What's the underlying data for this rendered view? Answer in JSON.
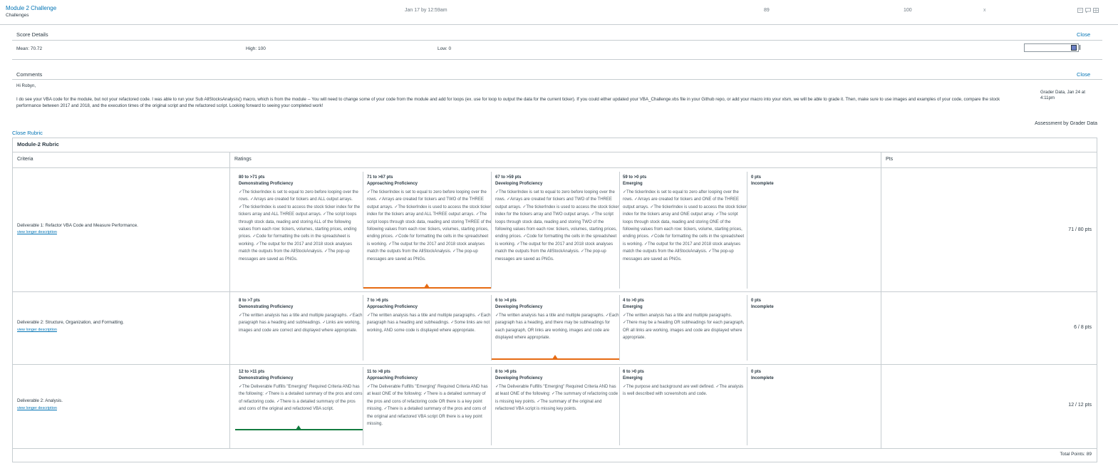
{
  "assignment": {
    "title": "Module 2 Challenge",
    "group": "Challenges",
    "due": "Jan 17 by 12:59am",
    "score": "89",
    "possible": "100",
    "x": "x"
  },
  "score_details": {
    "title": "Score Details",
    "close": "Close",
    "mean": "Mean: 70.72",
    "high": "High: 100",
    "low": "Low: 0"
  },
  "comments": {
    "title": "Comments",
    "close": "Close",
    "greeting": "Hi Robyn,",
    "body": "I do see your VBA code for the module, but not your refactored code. I was able to run your Sub AllStocksAnalysis() macro, which is from the module -- You will need to change some of your code from the module and add for loops (ex. use for loop to output the data for the current ticker). If you could either updated your VBA_Challenge.vbs file in your Github repo, or add your macro into your xlsm, we will be able to grade it. Then, make sure to use images and examples of your code, compare the stock performance between 2017 and 2018, and the execution times of the original script and the refactored script. Looking forward to seeing your completed work!",
    "grader": "Grader Data, Jan 24 at 4:11pm"
  },
  "rubric": {
    "close_link": "Close Rubric",
    "assessment_by": "Assessment by Grader Data",
    "title": "Module-2 Rubric",
    "col_criteria": "Criteria",
    "col_ratings": "Ratings",
    "col_pts": "Pts",
    "view_longer": "view longer description",
    "total": "Total Points: 89",
    "selected_color_orange": "#e66b13",
    "selected_color_green": "#127b3f",
    "criteria": [
      {
        "name": "Deliverable 1: Refactor VBA Code and Measure Performance.",
        "pts": "71 / 80 pts",
        "ratings": [
          {
            "pts": "80 to >71 pts",
            "name": "Demonstrating Proficiency",
            "desc": "✓The tickerIndex is set to equal to zero before looping over the rows. ✓Arrays are created for tickers and ALL output arrays. ✓The tickerIndex is used to access the stock ticker index for the tickers array and ALL THREE output arrays. ✓The script loops through stock data, reading and storing ALL of the following values from each row: tickers, volumes, starting prices, ending prices. ✓Code for formatting the cells in the spreadsheet is working. ✓The output for the 2017 and 2018 stock analyses match the outputs from the AllStockAnalysis. ✓The pop-up messages are saved as PNGs."
          },
          {
            "pts": "71 to >67 pts",
            "name": "Approaching Proficiency",
            "desc": "✓The tickerIndex is set to equal to zero before looping over the rows. ✓Arrays are created for tickers and TWO of the THREE output arrays. ✓The tickerIndex is used to access the stock ticker index for the tickers array and ALL THREE output arrays. ✓The script loops through stock data, reading and storing THREE of the following values from each row: tickers, volumes, starting prices, ending prices. ✓Code for formatting the cells in the spreadsheet is working. ✓The output for the 2017 and 2018 stock analyses match the outputs from the AllStockAnalysis. ✓The pop-up messages are saved as PNGs."
          },
          {
            "pts": "67 to >59 pts",
            "name": "Developing Proficiency",
            "desc": "✓The tickerIndex is set to equal to zero before looping over the rows. ✓Arrays are created for tickers and TWO of the THREE output arrays. ✓The tickerIndex is used to access the stock ticker index for the tickers array and TWO output arrays. ✓The script loops through stock data, reading and storing TWO of the following values from each row: tickers, volumes, starting prices, ending prices. ✓Code for formatting the cells in the spreadsheet is working. ✓The output for the 2017 and 2018 stock analyses match the outputs from the AllStockAnalysis. ✓The pop-up messages are saved as PNGs."
          },
          {
            "pts": "59 to >0 pts",
            "name": "Emerging",
            "desc": "✓The tickerIndex is set to equal to zero after looping over the rows. ✓Arrays are created for tickers and ONE of the THREE output arrays. ✓The tickerIndex is used to access the stock ticker index for the tickers array and ONE output array. ✓The script loops through stock data, reading and storing ONE of the following values from each row: tickers, volume, starting prices, ending prices. ✓Code for formatting the cells in the spreadsheet is working. ✓The output for the 2017 and 2018 stock analyses match the outputs from the AllStockAnalysis. ✓The pop-up messages are saved as PNGs."
          },
          {
            "pts": "0 pts",
            "name": "Incomplete",
            "desc": ""
          }
        ]
      },
      {
        "name": "Deliverable 2: Structure, Organization, and Formatting.",
        "pts": "6 / 8 pts",
        "ratings": [
          {
            "pts": "8 to >7 pts",
            "name": "Demonstrating Proficiency",
            "desc": "✓The written analysis has a title and multiple paragraphs. ✓Each paragraph has a heading and subheadings. ✓Links are working, images and code are correct and displayed where appropriate."
          },
          {
            "pts": "7 to >6 pts",
            "name": "Approaching Proficiency",
            "desc": "✓The written analysis has a title and multiple paragraphs. ✓Each paragraph has a heading and subheadings. ✓Some links are not working, AND some code is displayed where appropriate."
          },
          {
            "pts": "6 to >4 pts",
            "name": "Developing Proficiency",
            "desc": "✓The written analysis has a title and multiple paragraphs. ✓Each paragraph has a heading, and there may be subheadings for each paragraph, OR links are working, images and code are displayed where appropriate."
          },
          {
            "pts": "4 to >0 pts",
            "name": "Emerging",
            "desc": "✓The written analysis has a title and multiple paragraphs. ✓There may be a heading OR subheadings for each paragraph, OR all links are working, images and code are displayed where appropriate."
          },
          {
            "pts": "0 pts",
            "name": "Incomplete",
            "desc": ""
          }
        ]
      },
      {
        "name": "Deliverable 2: Analysis.",
        "pts": "12 / 12 pts",
        "ratings": [
          {
            "pts": "12 to >11 pts",
            "name": "Demonstrating Proficiency",
            "desc": "✓The Deliverable Fulfills \"Emerging\" Required Criteria AND has the following: ✓There is a detailed summary of the pros and cons of refactoring code. ✓There is a detailed summary of the pros and cons of the original and refactored VBA script."
          },
          {
            "pts": "11 to >8 pts",
            "name": "Approaching Proficiency",
            "desc": "✓The Deliverable Fulfills \"Emerging\" Required Criteria AND has at least ONE of the following: ✓There is a detailed summary of the pros and cons of refactoring code OR there is a key point missing. ✓There is a detailed summary of the pros and cons of the original and refactored VBA script OR there is a key point missing."
          },
          {
            "pts": "8 to >6 pts",
            "name": "Developing Proficiency",
            "desc": "✓The Deliverable Fulfills \"Emerging\" Required Criteria AND has at least ONE of the following: ✓The summary of refactoring code is missing key points. ✓The summary of the original and refactored VBA script is missing key points."
          },
          {
            "pts": "6 to >0 pts",
            "name": "Emerging",
            "desc": "✓The purpose and background are well defined. ✓The analysis is well described with screenshots and code."
          },
          {
            "pts": "0 pts",
            "name": "Incomplete",
            "desc": ""
          }
        ]
      }
    ]
  }
}
